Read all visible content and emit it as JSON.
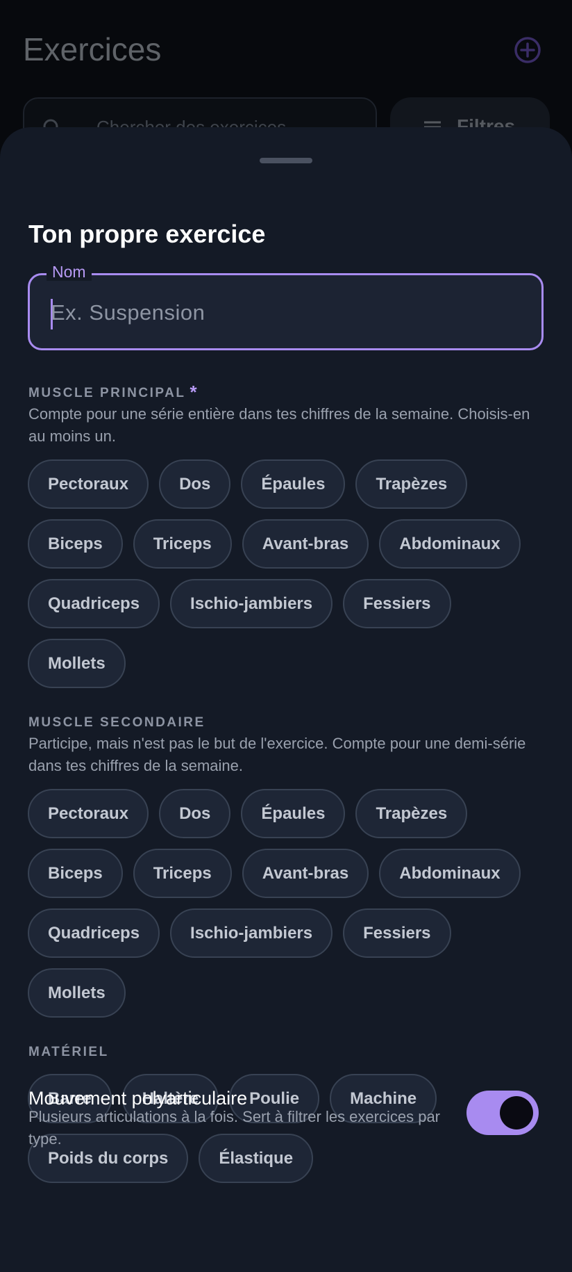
{
  "background": {
    "title": "Exercices",
    "search_placeholder": "Chercher des exercices",
    "filter_label": "Filtres"
  },
  "sheet": {
    "title": "Ton propre exercice",
    "name_field": {
      "label": "Nom",
      "placeholder": "Ex. Suspension",
      "value": ""
    },
    "primary": {
      "heading": "MUSCLE PRINCIPAL",
      "required_mark": "*",
      "description": "Compte pour une série entière dans tes chiffres de la semaine. Choisis-en au moins un.",
      "rows": [
        [
          "Pectoraux",
          "Dos",
          "Épaules",
          "Trapèzes"
        ],
        [
          "Biceps",
          "Triceps",
          "Avant-bras",
          "Abdominaux"
        ],
        [
          "Quadriceps",
          "Ischio-jambiers",
          "Fessiers"
        ],
        [
          "Mollets"
        ]
      ]
    },
    "secondary": {
      "heading": "MUSCLE SECONDAIRE",
      "description": "Participe, mais n'est pas le but de l'exercice. Compte pour une demi-série dans tes chiffres de la semaine.",
      "rows": [
        [
          "Pectoraux",
          "Dos",
          "Épaules",
          "Trapèzes"
        ],
        [
          "Biceps",
          "Triceps",
          "Avant-bras",
          "Abdominaux"
        ],
        [
          "Quadriceps",
          "Ischio-jambiers",
          "Fessiers"
        ],
        [
          "Mollets"
        ]
      ]
    },
    "equipment": {
      "heading": "MATÉRIEL",
      "rows": [
        [
          "Barre",
          "Haltère",
          "Poulie",
          "Machine"
        ],
        [
          "Poids du corps",
          "Élastique"
        ]
      ]
    },
    "compound": {
      "title": "Mouvement polyarticulaire",
      "description": "Plusieurs articulations à la fois. Sert à filtrer les exercices par type.",
      "enabled": true
    }
  },
  "colors": {
    "accent": "#a88bf0",
    "sheet_bg": "#141a26",
    "chip_bg": "#1e2636"
  },
  "icons": {
    "add": "add-circle-icon",
    "search": "search-icon",
    "filter": "tune-icon"
  }
}
